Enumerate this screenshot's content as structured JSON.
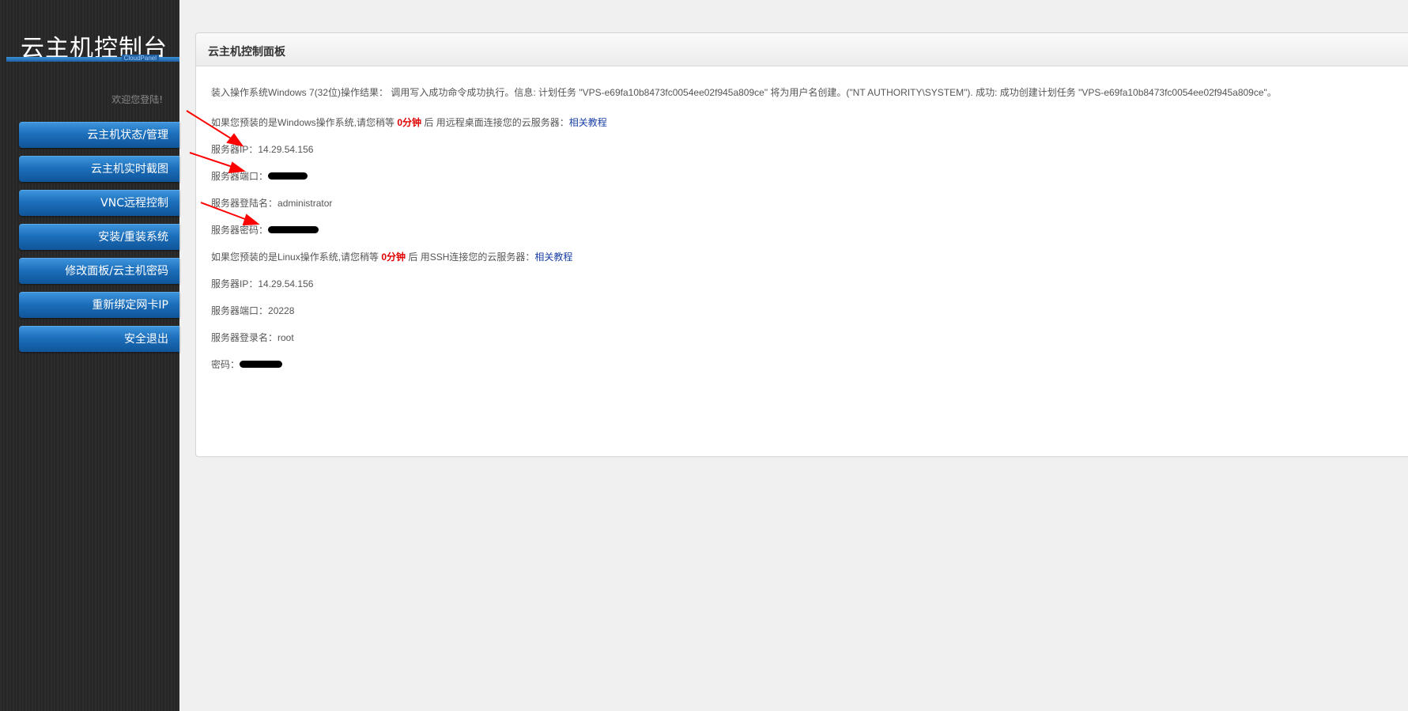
{
  "sidebar": {
    "logo_title": "云主机控制台",
    "logo_sub": "CloudPanel",
    "welcome": "欢迎您登陆!",
    "items": [
      {
        "label": "云主机状态/管理"
      },
      {
        "label": "云主机实时截图"
      },
      {
        "label": "VNC远程控制"
      },
      {
        "label": "安装/重装系统"
      },
      {
        "label": "修改面板/云主机密码"
      },
      {
        "label": "重新绑定网卡IP"
      },
      {
        "label": "安全退出"
      }
    ]
  },
  "panel": {
    "title": "云主机控制面板",
    "result_line": "装入操作系统Windows 7(32位)操作结果： 调用写入成功命令成功执行。信息: 计划任务 \"VPS-e69fa10b8473fc0054ee02f945a809ce\" 将为用户名创建。(\"NT AUTHORITY\\SYSTEM\"). 成功: 成功创建计划任务 \"VPS-e69fa10b8473fc0054ee02f945a809ce\"。",
    "windows": {
      "intro_pre": "如果您预装的是Windows操作系统,请您稍等 ",
      "wait": "0分钟",
      "intro_post": " 后 用远程桌面连接您的云服务器：",
      "link": "相关教程",
      "ip_label": "服务器IP：",
      "ip": "14.29.54.156",
      "port_label": "服务器端口：",
      "user_label": "服务器登陆名：",
      "user": "administrator",
      "pass_label": "服务器密码："
    },
    "linux": {
      "intro_pre": "如果您预装的是Linux操作系统,请您稍等 ",
      "wait": "0分钟",
      "intro_post": " 后 用SSH连接您的云服务器：",
      "link": "相关教程",
      "ip_label": "服务器IP：",
      "ip": "14.29.54.156",
      "port_label": "服务器端口：",
      "port": "20228",
      "user_label": "服务器登录名：",
      "user": "root",
      "pass_label": "密码："
    }
  },
  "colors": {
    "accent": "#1d6fbb",
    "highlight": "#e00000",
    "link": "#1a3fa6",
    "annotation": "#ff0000"
  }
}
